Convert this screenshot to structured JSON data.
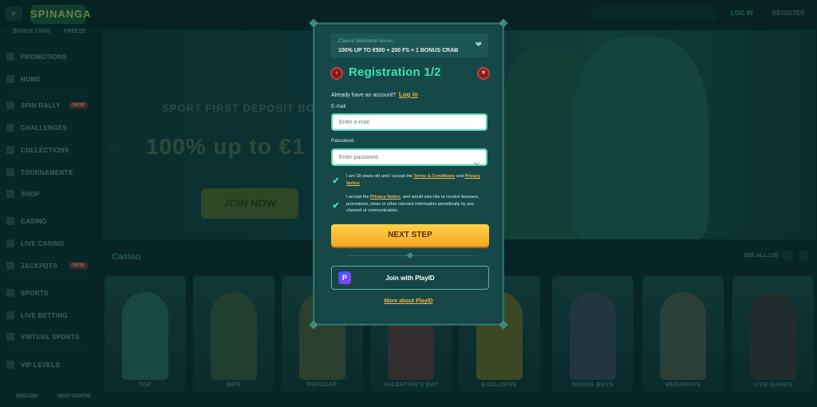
{
  "topbar": {
    "menu_icon": "hamburger-icon",
    "logo": "SPINANGA",
    "login": "LOG IN",
    "register": "REGISTER"
  },
  "sidebar": {
    "tabs": [
      "BONUS CRAB",
      "FREEZE"
    ],
    "items": [
      {
        "label": "PROMOTIONS",
        "icon": "gift-icon"
      },
      {
        "label": "HOME",
        "icon": "home-icon"
      },
      {
        "label": "SPIN RALLY",
        "icon": "flag-icon",
        "badge": "NEW"
      },
      {
        "label": "CHALLENGES",
        "icon": "target-icon"
      },
      {
        "label": "COLLECTIONS",
        "icon": "cards-icon"
      },
      {
        "label": "TOURNAMENTS",
        "icon": "trophy-icon"
      },
      {
        "label": "SHOP",
        "icon": "cart-icon"
      },
      {
        "label": "CASINO",
        "icon": "slot-icon"
      },
      {
        "label": "LIVE CASINO",
        "icon": "dealer-icon"
      },
      {
        "label": "JACKPOTS",
        "icon": "coin-icon",
        "badge": "NEW"
      },
      {
        "label": "SPORTS",
        "icon": "ball-icon"
      },
      {
        "label": "LIVE BETTING",
        "icon": "live-icon"
      },
      {
        "label": "VIRTUAL SPORTS",
        "icon": "vr-icon"
      },
      {
        "label": "VIP LEVELS",
        "icon": "crown-icon"
      }
    ],
    "footer": {
      "language": "ENGLISH",
      "help": "HELP CENTRE"
    }
  },
  "hero": {
    "subtitle": "SPORT FIRST DEPOSIT BO",
    "headline": "100% up to €1",
    "button": "JOIN NOW",
    "prev_arrow": "‹"
  },
  "casino": {
    "title": "Casino",
    "see_all": "SEE ALL (18)",
    "tiles": [
      {
        "label": "TOP",
        "color": "#2a6a60"
      },
      {
        "label": "NEW",
        "color": "#3a5a40"
      },
      {
        "label": "POPULAR",
        "color": "#4a5a3a"
      },
      {
        "label": "VALENTINE'S DAY",
        "color": "#5a3a3a"
      },
      {
        "label": "EXCLUSIVE",
        "color": "#6a6a2a"
      },
      {
        "label": "BONUS BUYS",
        "color": "#3a4a5a"
      },
      {
        "label": "MEGAWAYS",
        "color": "#4a5a4a"
      },
      {
        "label": "LIVE GAMES",
        "color": "#3a3a3a"
      }
    ]
  },
  "modal": {
    "bonus_title": "Casino Welcome bonus",
    "bonus_offer": "100% UP TO €500 + 200 FS + 1 BONUS CRAB",
    "title": "Registration 1/2",
    "back_icon": "‹",
    "close_icon": "✕",
    "have_account": "Already have an account?",
    "login_link": "Log in",
    "email_label": "E-mail",
    "email_placeholder": "Enter e-mail",
    "password_label": "Password",
    "password_placeholder": "Enter password",
    "terms_1_pre": "I am 18 years old and I accept the ",
    "terms_1_link1": "Terms & Conditions",
    "terms_1_mid": " and ",
    "terms_1_link2": "Privacy Notice",
    "terms_2_pre": "I accept the ",
    "terms_2_link": "Privacy Notice",
    "terms_2_post": ", and would also like to receive bonuses, promotions, news or other relevant information periodically by any channel of communication.",
    "next_button": "NEXT STEP",
    "playid_button": "Join with PlayID",
    "more_link": "More about PlayID"
  }
}
